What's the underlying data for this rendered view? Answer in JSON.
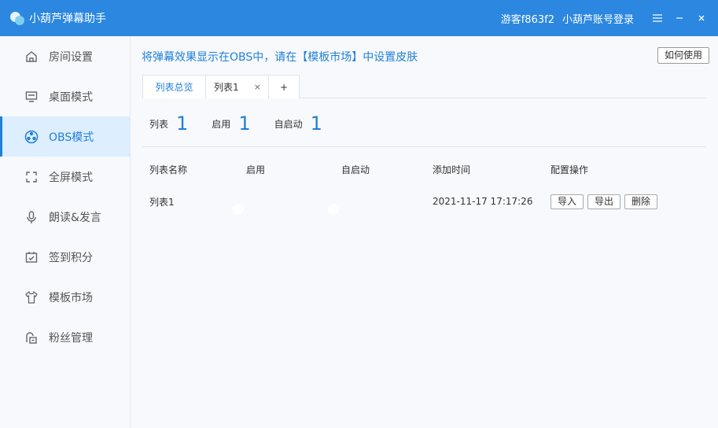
{
  "app": {
    "title": "小葫芦弹幕助手",
    "user": "游客f863f2",
    "login": "小葫芦账号登录",
    "menu_icon": "menu-icon",
    "minimize_icon": "minimize-icon",
    "close_icon": "close-icon"
  },
  "sidebar": {
    "items": [
      {
        "label": "房间设置",
        "icon": "home-icon"
      },
      {
        "label": "桌面模式",
        "icon": "monitor-icon"
      },
      {
        "label": "OBS模式",
        "icon": "obs-icon"
      },
      {
        "label": "全屏模式",
        "icon": "fullscreen-icon"
      },
      {
        "label": "朗读&发言",
        "icon": "microphone-icon"
      },
      {
        "label": "签到积分",
        "icon": "calendar-check-icon"
      },
      {
        "label": "模板市场",
        "icon": "shirt-icon"
      },
      {
        "label": "粉丝管理",
        "icon": "fan-lock-icon"
      }
    ],
    "active_index": 2
  },
  "main": {
    "hint": "将弹幕效果显示在OBS中，请在【模板市场】中设置皮肤",
    "help_button": "如何使用",
    "tabs": {
      "overview": "列表总览",
      "list1": "列表1",
      "close": "×",
      "add": "+"
    },
    "stats": [
      {
        "label": "列表",
        "value": "1"
      },
      {
        "label": "启用",
        "value": "1"
      },
      {
        "label": "自启动",
        "value": "1"
      }
    ],
    "table": {
      "headers": [
        "列表名称",
        "启用",
        "自启动",
        "添加时间",
        "配置操作"
      ],
      "rows": [
        {
          "name": "列表1",
          "enabled": true,
          "autostart": true,
          "time": "2021-11-17 17:17:26",
          "actions": [
            "导入",
            "导出",
            "删除"
          ]
        }
      ]
    }
  },
  "colors": {
    "accent": "#1f7fd9",
    "titlebar": "#2b87e0",
    "toggle_on": "#3a9af0"
  }
}
